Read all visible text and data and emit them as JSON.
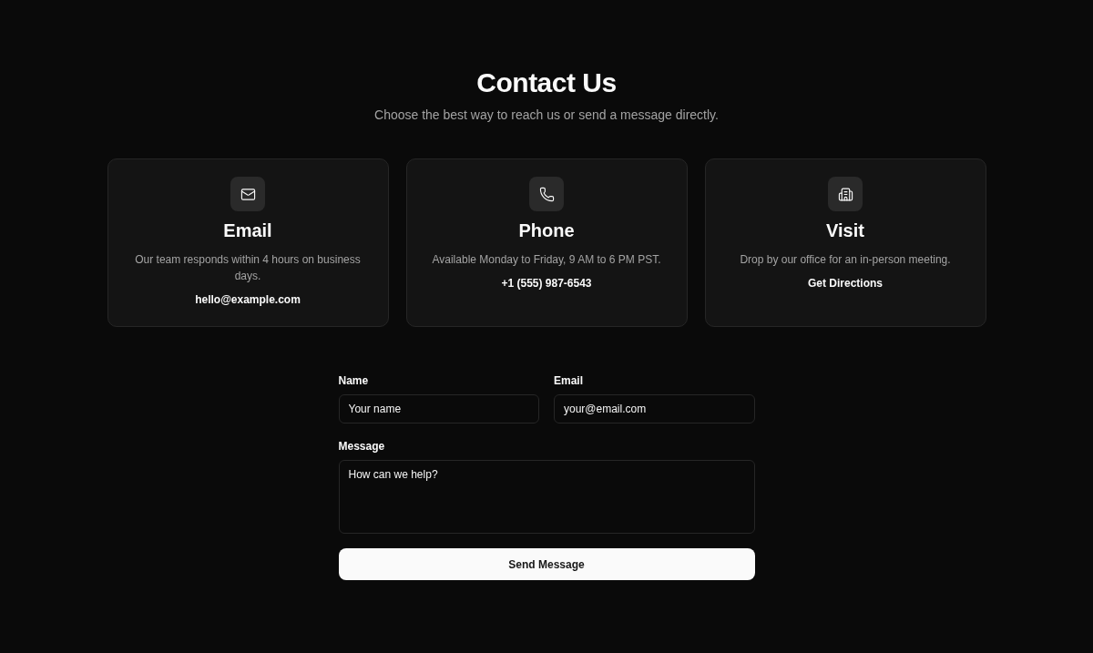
{
  "header": {
    "title": "Contact Us",
    "subtitle": "Choose the best way to reach us or send a message directly."
  },
  "cards": [
    {
      "kind": "email",
      "title": "Email",
      "description": "Our team responds within 4 hours on business days.",
      "link": "hello@example.com"
    },
    {
      "kind": "phone",
      "title": "Phone",
      "description": "Available Monday to Friday, 9 AM to 6 PM PST.",
      "link": "+1 (555) 987-6543"
    },
    {
      "kind": "visit",
      "title": "Visit",
      "description": "Drop by our office for an in-person meeting.",
      "link": "Get Directions"
    }
  ],
  "form": {
    "fields": [
      {
        "kind": "input",
        "label": "Name",
        "placeholder": "Your name"
      },
      {
        "kind": "input",
        "label": "Email",
        "placeholder": "your@email.com"
      },
      {
        "kind": "textarea",
        "label": "Message",
        "placeholder": "How can we help?"
      }
    ],
    "submit": "Send Message"
  }
}
